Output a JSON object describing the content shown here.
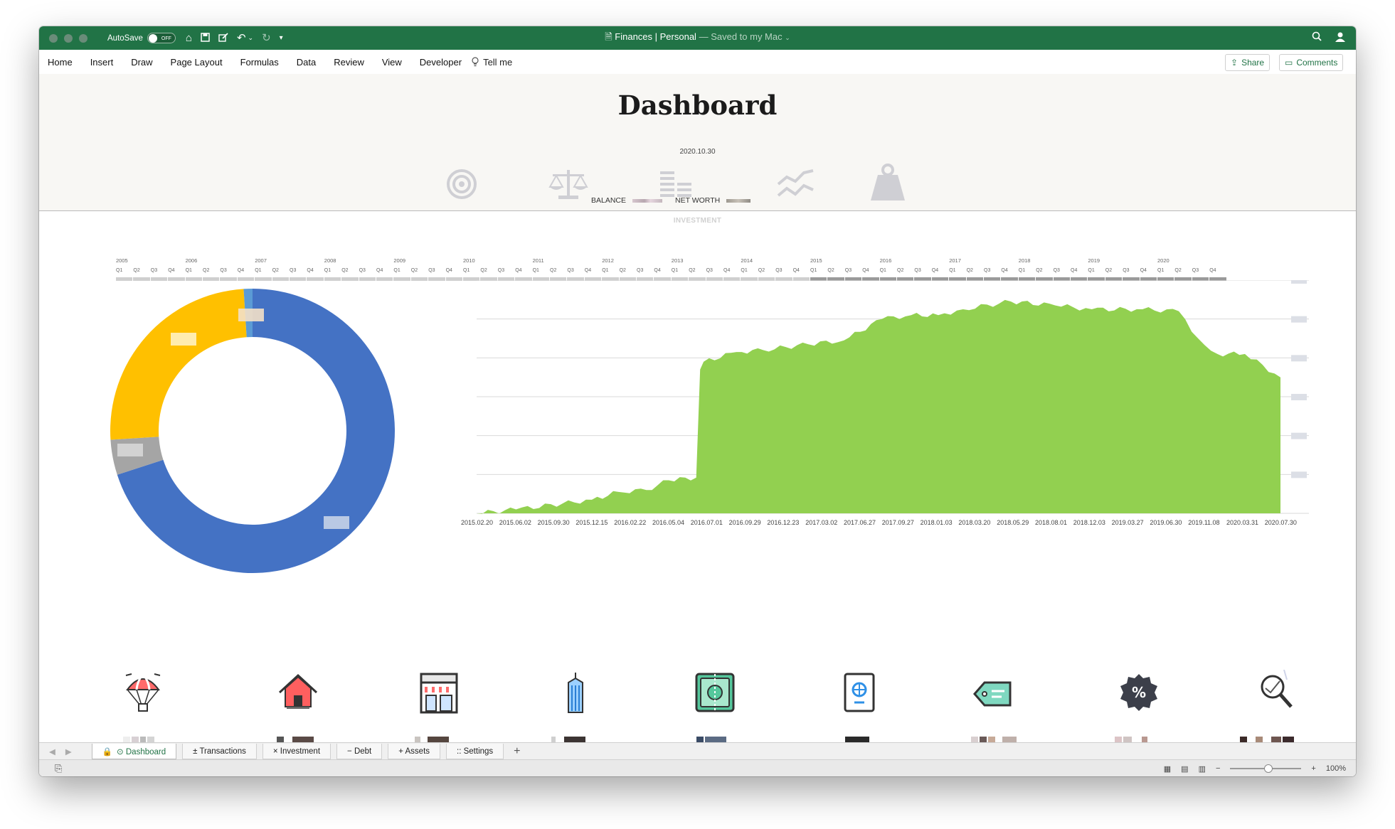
{
  "titlebar": {
    "autosave_label": "AutoSave",
    "autosave_state": "OFF",
    "doc_name": "Finances | Personal",
    "saved_status": "— Saved to my Mac"
  },
  "ribbon": {
    "tabs": [
      "Home",
      "Insert",
      "Draw",
      "Page Layout",
      "Formulas",
      "Data",
      "Review",
      "View",
      "Developer"
    ],
    "tell_me": "Tell me",
    "share": "Share",
    "comments": "Comments"
  },
  "dashboard": {
    "title": "Dashboard",
    "date": "2020.10.30",
    "balance_label": "BALANCE",
    "networth_label": "NET WORTH",
    "section_label": "INVESTMENT",
    "header_icons": [
      "target-icon",
      "scale-icon",
      "stack-list-icon",
      "trend-lines-icon",
      "weight-bag-icon"
    ]
  },
  "timeline": {
    "years": [
      "2005",
      "2006",
      "2007",
      "2008",
      "2009",
      "2010",
      "2011",
      "2012",
      "2013",
      "2014",
      "2015",
      "2016",
      "2017",
      "2018",
      "2019",
      "2020"
    ],
    "quarters": [
      "Q1",
      "Q2",
      "Q3",
      "Q4"
    ],
    "highlight_from_year": "2015"
  },
  "bottom_icons": [
    "parachute-icon",
    "house-icon",
    "storefront-icon",
    "skyscraper-icon",
    "cash-icon",
    "passport-icon",
    "price-tag-icon",
    "percent-badge-icon",
    "magnifier-chart-icon"
  ],
  "chart_data": [
    {
      "type": "pie",
      "variant": "donut",
      "title": "",
      "series": [
        {
          "name": "",
          "value": 70,
          "color": "#4472c4"
        },
        {
          "name": "",
          "value": 4,
          "color": "#a5a5a5"
        },
        {
          "name": "",
          "value": 25,
          "color": "#ffc000"
        },
        {
          "name": "",
          "value": 1,
          "color": "#5b9bd5"
        }
      ]
    },
    {
      "type": "area",
      "title": "",
      "color": "#92d050",
      "ylim": [
        0,
        6
      ],
      "ytick_labels": "obscured",
      "x_tick_labels": [
        "2015.02.20",
        "2015.06.02",
        "2015.09.30",
        "2015.12.15",
        "2016.02.22",
        "2016.05.04",
        "2016.07.01",
        "2016.09.29",
        "2016.12.23",
        "2017.03.02",
        "2017.06.27",
        "2017.09.27",
        "2018.01.03",
        "2018.03.20",
        "2018.05.29",
        "2018.08.01",
        "2018.12.03",
        "2019.03.27",
        "2019.06.30",
        "2019.11.08",
        "2020.03.31",
        "2020.07.30"
      ],
      "points": [
        {
          "x": "2015.02.20",
          "y": 0.0
        },
        {
          "x": "2015.06.02",
          "y": 0.1
        },
        {
          "x": "2015.09.30",
          "y": 0.25
        },
        {
          "x": "2015.12.15",
          "y": 0.35
        },
        {
          "x": "2016.02.22",
          "y": 0.55
        },
        {
          "x": "2016.05.04",
          "y": 0.6
        },
        {
          "x": "2016.07.01",
          "y": 0.85
        },
        {
          "x": "2016.09.10",
          "y": 0.92
        },
        {
          "x": "2016.09.20",
          "y": 3.7
        },
        {
          "x": "2016.09.29",
          "y": 3.9
        },
        {
          "x": "2016.12.23",
          "y": 4.15
        },
        {
          "x": "2017.03.02",
          "y": 4.2
        },
        {
          "x": "2017.06.27",
          "y": 4.35
        },
        {
          "x": "2017.09.27",
          "y": 4.45
        },
        {
          "x": "2018.01.03",
          "y": 5.0
        },
        {
          "x": "2018.03.20",
          "y": 5.1
        },
        {
          "x": "2018.05.29",
          "y": 5.1
        },
        {
          "x": "2018.08.01",
          "y": 5.25
        },
        {
          "x": "2018.12.03",
          "y": 5.45
        },
        {
          "x": "2019.03.27",
          "y": 5.35
        },
        {
          "x": "2019.06.30",
          "y": 5.25
        },
        {
          "x": "2019.11.08",
          "y": 5.25
        },
        {
          "x": "2020.02.10",
          "y": 5.2
        },
        {
          "x": "2020.03.31",
          "y": 4.5
        },
        {
          "x": "2020.05.20",
          "y": 4.1
        },
        {
          "x": "2020.07.30",
          "y": 4.1
        },
        {
          "x": "2020.10.30",
          "y": 3.5
        }
      ]
    }
  ],
  "sheet_tabs": [
    {
      "label": "⊙ Dashboard",
      "active": true
    },
    {
      "label": "± Transactions",
      "active": false
    },
    {
      "label": "× Investment",
      "active": false
    },
    {
      "label": "− Debt",
      "active": false
    },
    {
      "label": "+ Assets",
      "active": false
    },
    {
      "label": ":: Settings",
      "active": false
    }
  ],
  "statusbar": {
    "zoom": "100%"
  }
}
